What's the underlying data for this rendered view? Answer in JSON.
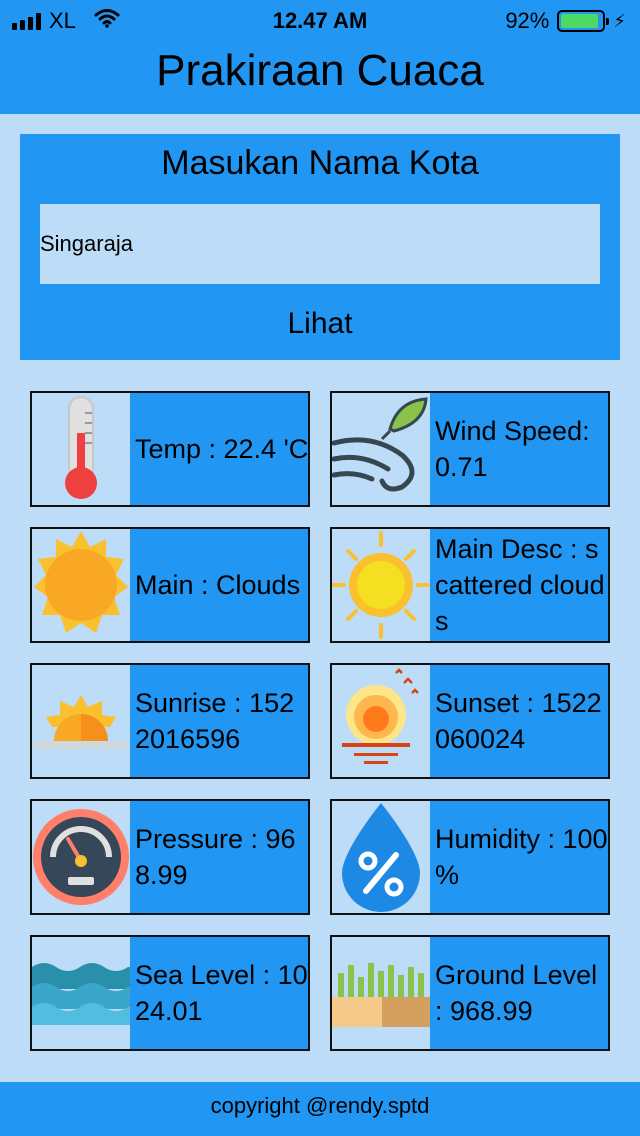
{
  "status_bar": {
    "carrier": "XL",
    "time": "12.47 AM",
    "battery_percent": "92%",
    "battery_level": 0.92,
    "signal_icon": "signal-bars-icon",
    "wifi_icon": "wifi-icon",
    "charging_icon": "charging-bolt-icon"
  },
  "header": {
    "title": "Prakiraan Cuaca"
  },
  "search": {
    "label": "Masukan Nama Kota",
    "value": "Singaraja",
    "button_label": "Lihat"
  },
  "tiles": [
    {
      "text": "Temp : 22.4 'C",
      "icon": "thermometer-icon"
    },
    {
      "text": "Wind Speed: 0.71",
      "icon": "wind-icon"
    },
    {
      "text": "Main : Clouds",
      "icon": "sun-icon"
    },
    {
      "text": "Main Desc : scattered clouds",
      "icon": "bright-sun-icon"
    },
    {
      "text": "Sunrise : 1522016596",
      "icon": "sunrise-icon"
    },
    {
      "text": "Sunset : 1522060024",
      "icon": "sunset-icon"
    },
    {
      "text": "Pressure : 968.99",
      "icon": "pressure-gauge-icon"
    },
    {
      "text": "Humidity : 100 %",
      "icon": "humidity-drop-icon"
    },
    {
      "text": "Sea Level : 1024.01",
      "icon": "waves-icon"
    },
    {
      "text": "Ground Level : 968.99",
      "icon": "ground-icon"
    }
  ],
  "footer": {
    "text": "copyright @rendy.sptd"
  },
  "colors": {
    "primary": "#2196f3",
    "background": "#bcdcf8",
    "battery": "#4cd964"
  }
}
